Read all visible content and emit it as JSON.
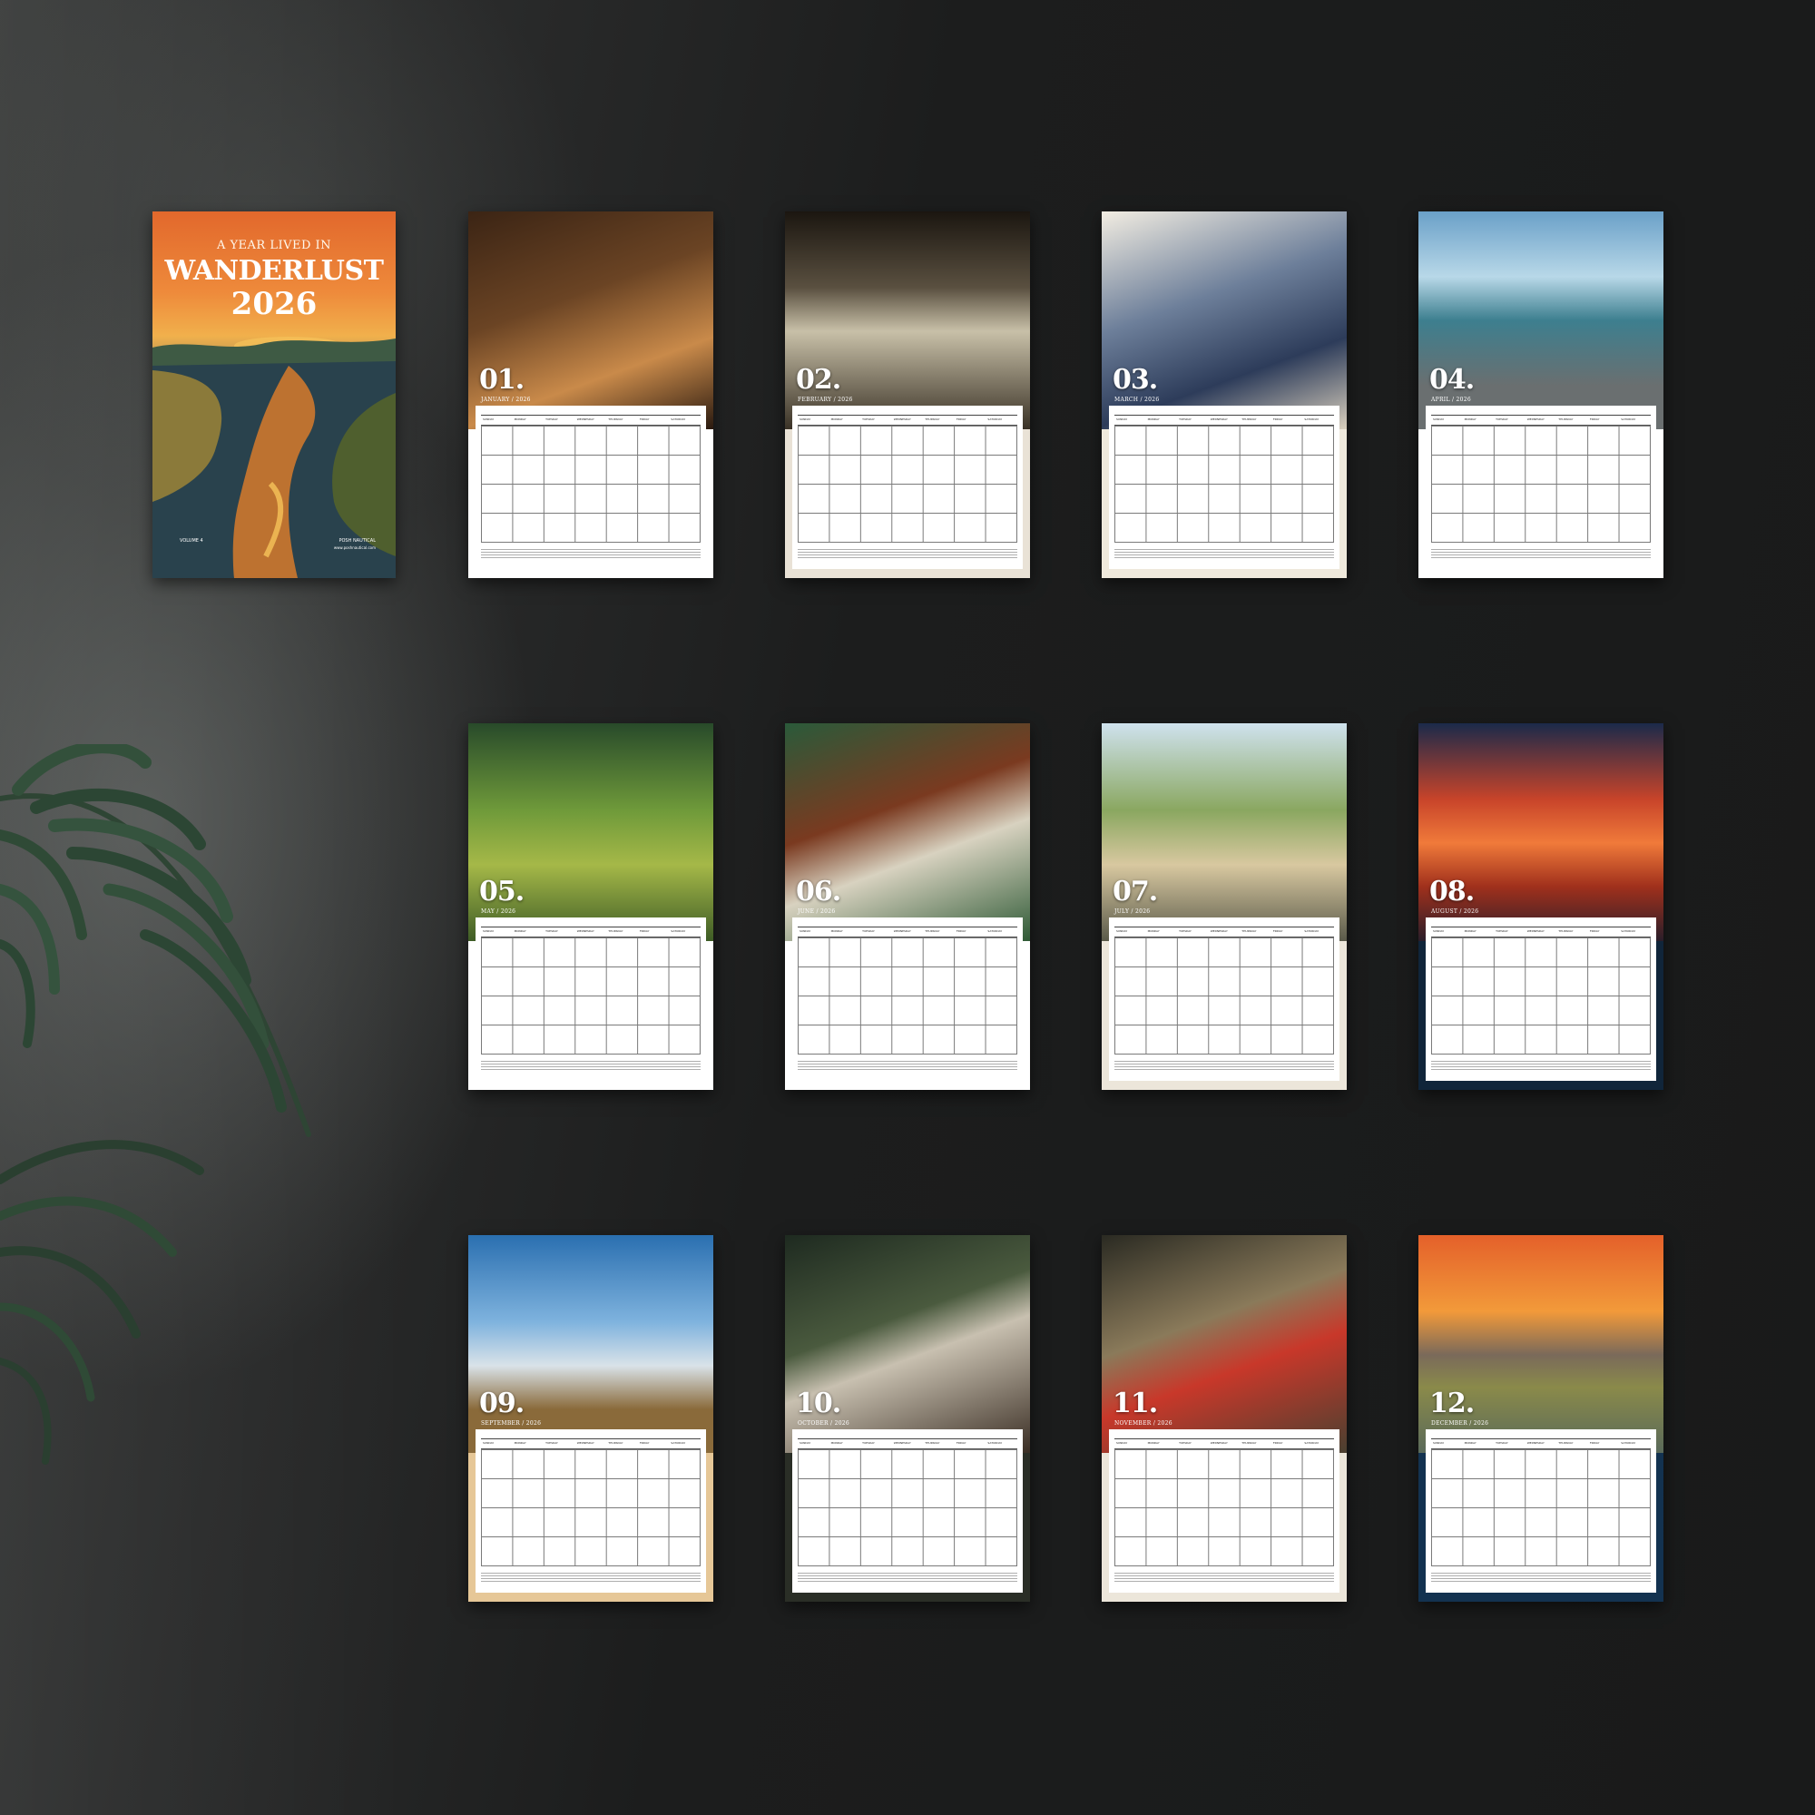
{
  "cover": {
    "kicker": "A YEAR LIVED IN",
    "title": "WANDERLUST",
    "year": "2026",
    "volume": "VOLUME 4",
    "publisher": "POSH NAUTICAL",
    "url": "www.poshnautical.com"
  },
  "weekdays": [
    "SUNDAY",
    "MONDAY",
    "TUESDAY",
    "WEDNESDAY",
    "THURSDAY",
    "FRIDAY",
    "SATURDAY"
  ],
  "months": [
    {
      "num": "01.",
      "label": "JANUARY / 2026"
    },
    {
      "num": "02.",
      "label": "FEBRUARY / 2026"
    },
    {
      "num": "03.",
      "label": "MARCH / 2026"
    },
    {
      "num": "04.",
      "label": "APRIL / 2026"
    },
    {
      "num": "05.",
      "label": "MAY / 2026"
    },
    {
      "num": "06.",
      "label": "JUNE / 2026"
    },
    {
      "num": "07.",
      "label": "JULY / 2026"
    },
    {
      "num": "08.",
      "label": "AUGUST / 2026"
    },
    {
      "num": "09.",
      "label": "SEPTEMBER / 2026"
    },
    {
      "num": "10.",
      "label": "OCTOBER / 2026"
    },
    {
      "num": "11.",
      "label": "NOVEMBER / 2026"
    },
    {
      "num": "12.",
      "label": "DECEMBER / 2026"
    }
  ],
  "palette": {
    "wall": "#1d1e1e",
    "leaf": "#2f4a36"
  }
}
